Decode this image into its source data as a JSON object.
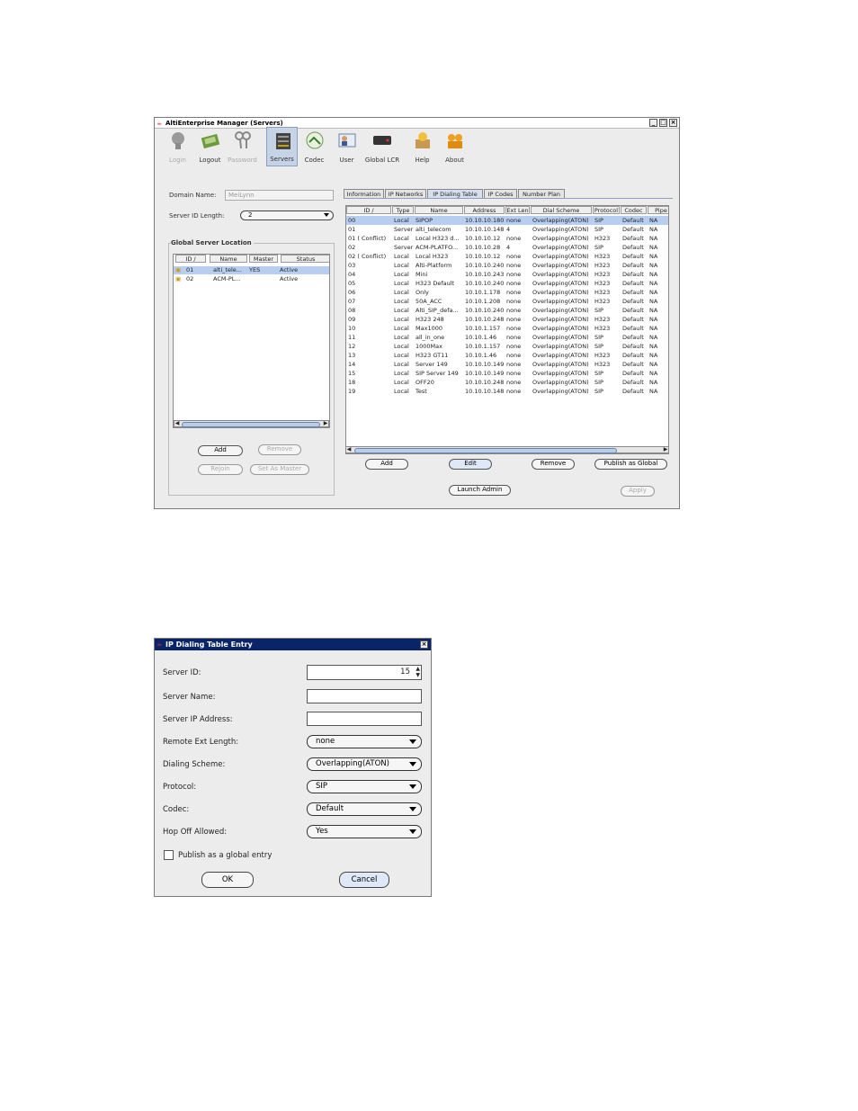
{
  "manager": {
    "title": "AltiEnterprise Manager  (Servers)",
    "toolbar": [
      {
        "label": "Login",
        "icon": "login-icon",
        "disabled": true
      },
      {
        "label": "Logout",
        "icon": "logout-icon",
        "disabled": false
      },
      {
        "label": "Password",
        "icon": "password-icon",
        "disabled": true
      },
      {
        "label": "Servers",
        "icon": "servers-icon",
        "disabled": false,
        "selected": true
      },
      {
        "label": "Codec",
        "icon": "codec-icon",
        "disabled": false
      },
      {
        "label": "User",
        "icon": "user-icon",
        "disabled": false
      },
      {
        "label": "Global LCR",
        "icon": "global-lcr-icon",
        "disabled": false
      },
      {
        "label": "Help",
        "icon": "help-icon",
        "disabled": false
      },
      {
        "label": "About",
        "icon": "about-icon",
        "disabled": false
      }
    ],
    "domain_name_label": "Domain Name:",
    "domain_name_value": "MeiLynn",
    "server_id_length_label": "Server ID Length:",
    "server_id_length_value": "2",
    "global_server_location_label": "Global Server Location",
    "gsl_columns": [
      "ID /",
      "Name",
      "Master",
      "Status"
    ],
    "gsl_rows": [
      {
        "id": "01",
        "name": "alti_tele...",
        "master": "YES",
        "status": "Active"
      },
      {
        "id": "02",
        "name": "ACM-PL...",
        "master": "",
        "status": "Active"
      }
    ],
    "left_buttons": {
      "add": "Add",
      "remove": "Remove",
      "rejoin": "Rejoin",
      "set_master": "Set As Master"
    },
    "tabs": [
      "Information",
      "IP Networks",
      "IP Dialing Table",
      "IP Codes",
      "Number Plan"
    ],
    "table_columns": [
      "ID /",
      "Type",
      "Name",
      "Address",
      "Ext Len",
      "Dial Scheme",
      "Protocol",
      "Codec",
      "Pipe"
    ],
    "table_rows": [
      [
        "00",
        "Local",
        "SIPOP",
        "10.10.10.180",
        "none",
        "Overlapping(ATON)",
        "SIP",
        "Default",
        "NA"
      ],
      [
        "01",
        "Server",
        "alti_telecom",
        "10.10.10.148",
        "4",
        "Overlapping(ATON)",
        "SIP",
        "Default",
        "NA"
      ],
      [
        "01 ( Conflict)",
        "Local",
        "Local H323 d...",
        "10.10.10.12",
        "none",
        "Overlapping(ATON)",
        "H323",
        "Default",
        "NA"
      ],
      [
        "02",
        "Server",
        "ACM-PLATFO...",
        "10.10.10.28",
        "4",
        "Overlapping(ATON)",
        "SIP",
        "Default",
        "NA"
      ],
      [
        "02 ( Conflict)",
        "Local",
        "Local H323",
        "10.10.10.12",
        "none",
        "Overlapping(ATON)",
        "H323",
        "Default",
        "NA"
      ],
      [
        "03",
        "Local",
        "Alti-Platform",
        "10.10.10.240",
        "none",
        "Overlapping(ATON)",
        "H323",
        "Default",
        "NA"
      ],
      [
        "04",
        "Local",
        "Mini",
        "10.10.10.243",
        "none",
        "Overlapping(ATON)",
        "H323",
        "Default",
        "NA"
      ],
      [
        "05",
        "Local",
        "H323 Default",
        "10.10.10.240",
        "none",
        "Overlapping(ATON)",
        "H323",
        "Default",
        "NA"
      ],
      [
        "06",
        "Local",
        "Only",
        "10.10.1.178",
        "none",
        "Overlapping(ATON)",
        "H323",
        "Default",
        "NA"
      ],
      [
        "07",
        "Local",
        "50A_ACC",
        "10.10.1.208",
        "none",
        "Overlapping(ATON)",
        "H323",
        "Default",
        "NA"
      ],
      [
        "08",
        "Local",
        "Alti_SIP_defa...",
        "10.10.10.240",
        "none",
        "Overlapping(ATON)",
        "SIP",
        "Default",
        "NA"
      ],
      [
        "09",
        "Local",
        "H323 248",
        "10.10.10.248",
        "none",
        "Overlapping(ATON)",
        "H323",
        "Default",
        "NA"
      ],
      [
        "10",
        "Local",
        "Max1000",
        "10.10.1.157",
        "none",
        "Overlapping(ATON)",
        "H323",
        "Default",
        "NA"
      ],
      [
        "11",
        "Local",
        "all_in_one",
        "10.10.1.46",
        "none",
        "Overlapping(ATON)",
        "SIP",
        "Default",
        "NA"
      ],
      [
        "12",
        "Local",
        "1000Max",
        "10.10.1.157",
        "none",
        "Overlapping(ATON)",
        "SIP",
        "Default",
        "NA"
      ],
      [
        "13",
        "Local",
        "H323 GT11",
        "10.10.1.46",
        "none",
        "Overlapping(ATON)",
        "H323",
        "Default",
        "NA"
      ],
      [
        "14",
        "Local",
        "Server 149",
        "10.10.10.149",
        "none",
        "Overlapping(ATON)",
        "H323",
        "Default",
        "NA"
      ],
      [
        "15",
        "Local",
        "SIP Server 149",
        "10.10.10.149",
        "none",
        "Overlapping(ATON)",
        "SIP",
        "Default",
        "NA"
      ],
      [
        "18",
        "Local",
        "OFF20",
        "10.10.10.248",
        "none",
        "Overlapping(ATON)",
        "SIP",
        "Default",
        "NA"
      ],
      [
        "19",
        "Local",
        "Test",
        "10.10.10.148",
        "none",
        "Overlapping(ATON)",
        "SIP",
        "Default",
        "NA"
      ]
    ],
    "right_buttons": {
      "add": "Add",
      "edit": "Edit",
      "remove": "Remove",
      "publish": "Publish as Global",
      "launch": "Launch Admin",
      "apply": "Apply"
    }
  },
  "dialog": {
    "title": "IP Dialing Table Entry",
    "server_id_label": "Server ID:",
    "server_id_value": "15",
    "server_name_label": "Server Name:",
    "server_name_value": "",
    "server_ip_label": "Server IP Address:",
    "server_ip_value": "",
    "remote_ext_label": "Remote Ext Length:",
    "remote_ext_value": "none",
    "dialing_scheme_label": "Dialing Scheme:",
    "dialing_scheme_value": "Overlapping(ATON)",
    "protocol_label": "Protocol:",
    "protocol_value": "SIP",
    "codec_label": "Codec:",
    "codec_value": "Default",
    "hop_off_label": "Hop Off Allowed:",
    "hop_off_value": "Yes",
    "publish_label": "Publish as a global entry",
    "publish_checked": false,
    "ok_label": "OK",
    "cancel_label": "Cancel"
  }
}
